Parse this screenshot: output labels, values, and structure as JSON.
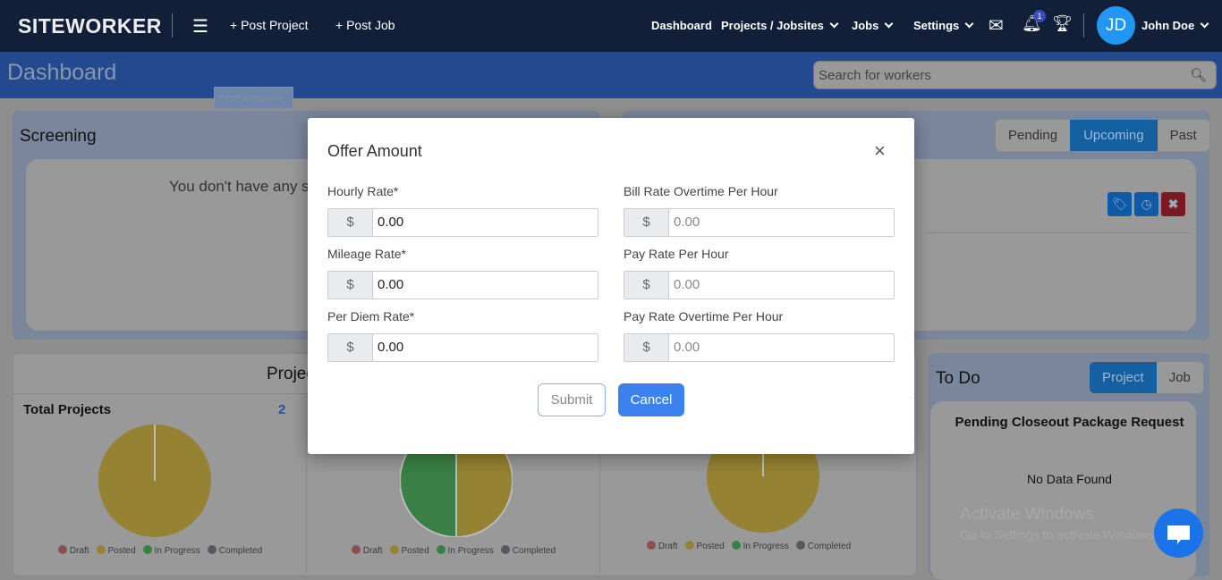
{
  "header": {
    "logo": "SITEWORKER",
    "post_project": "+ Post Project",
    "post_job": "+ Post Job",
    "nav": [
      "Dashboard",
      "Projects / Jobsites",
      "Jobs",
      "Settings"
    ],
    "notification_count": "1",
    "avatar_initials": "JD",
    "user_name": "John Doe"
  },
  "page": {
    "title": "Dashboard",
    "search_placeholder": "Search for workers",
    "tooltip": "Start a capture"
  },
  "screening": {
    "title": "Screening",
    "empty_text": "You don't have any s"
  },
  "schedule": {
    "tabs": [
      "Pending",
      "Upcoming",
      "Past"
    ],
    "active_tab": "Upcoming"
  },
  "projects": {
    "title": "Projec",
    "total_label": "Total Projects",
    "total_value": "2",
    "legend": [
      "Draft",
      "Posted",
      "In Progress",
      "Completed"
    ],
    "legend_colors": [
      "#e06b6b",
      "#c9a93a",
      "#3a9a4a",
      "#6a707c"
    ],
    "charts": [
      {
        "Draft": 0,
        "Posted": 1,
        "In Progress": 0,
        "Completed": 0
      },
      {
        "Draft": 0,
        "Posted": 1,
        "In Progress": 1,
        "Completed": 0
      },
      {
        "Draft": 0,
        "Posted": 1,
        "In Progress": 0,
        "Completed": 0
      }
    ]
  },
  "todo": {
    "title": "To Do",
    "tabs": [
      "Project",
      "Job"
    ],
    "active_tab": "Project",
    "section": "Pending Closeout Package Request",
    "empty": "No Data Found"
  },
  "modal": {
    "title": "Offer Amount",
    "currency": "$",
    "left": [
      {
        "label": "Hourly Rate*",
        "value": "0.00"
      },
      {
        "label": "Mileage Rate*",
        "value": "0.00"
      },
      {
        "label": "Per Diem Rate*",
        "value": "0.00"
      }
    ],
    "right": [
      {
        "label": "Bill Rate Overtime Per Hour",
        "placeholder": "0.00"
      },
      {
        "label": "Pay Rate Per Hour",
        "placeholder": "0.00"
      },
      {
        "label": "Pay Rate Overtime Per Hour",
        "placeholder": "0.00"
      }
    ],
    "submit": "Submit",
    "cancel": "Cancel"
  },
  "watermark": {
    "line1": "Activate Windows",
    "line2": "Go to Settings to activate Windows."
  }
}
